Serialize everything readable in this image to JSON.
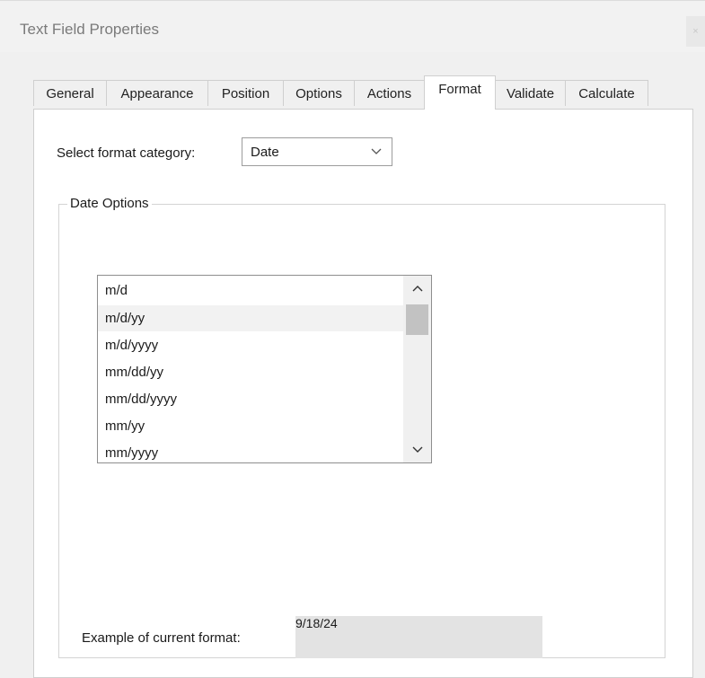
{
  "window": {
    "title": "Text Field Properties",
    "close_glyph": "×"
  },
  "tabs": [
    {
      "label": "General",
      "active": false
    },
    {
      "label": "Appearance",
      "active": false
    },
    {
      "label": "Position",
      "active": false
    },
    {
      "label": "Options",
      "active": false
    },
    {
      "label": "Actions",
      "active": false
    },
    {
      "label": "Format",
      "active": true
    },
    {
      "label": "Validate",
      "active": false
    },
    {
      "label": "Calculate",
      "active": false
    }
  ],
  "format": {
    "category_label": "Select format category:",
    "category_value": "Date"
  },
  "date_options": {
    "legend": "Date Options",
    "formats": [
      "m/d",
      "m/d/yy",
      "m/d/yyyy",
      "mm/dd/yy",
      "mm/dd/yyyy",
      "mm/yy",
      "mm/yyyy"
    ],
    "selected": "m/d/yy"
  },
  "example": {
    "label": "Example of current format:",
    "value": "9/18/24"
  },
  "icons": {
    "dropdown": "chevron-down-icon",
    "scroll_up": "chevron-up-icon",
    "scroll_down": "chevron-down-icon",
    "close": "close-icon"
  },
  "colors": {
    "dialog_bg": "#f0f0f0",
    "panel_bg": "#ffffff",
    "selected_row": "#f2f2f2",
    "example_field_bg": "#e3e3e3"
  }
}
